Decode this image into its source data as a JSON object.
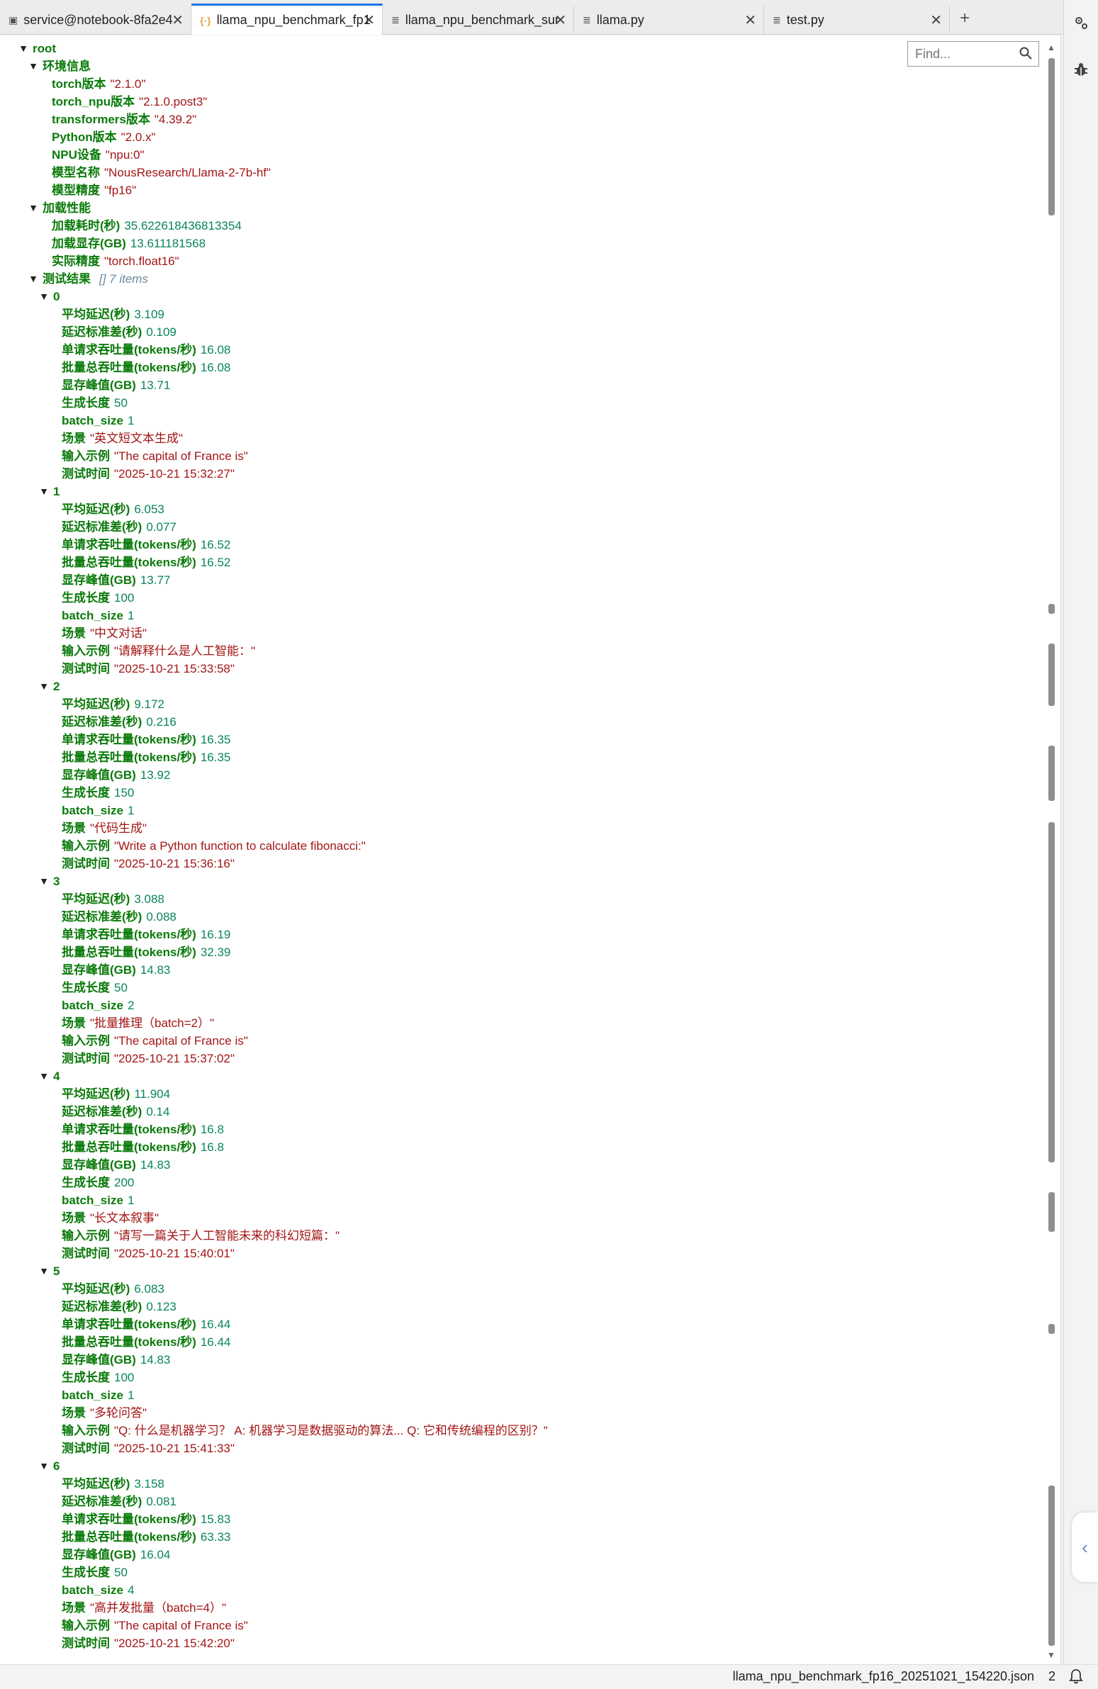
{
  "tabs": [
    {
      "icon": "terminal-icon",
      "label": "service@notebook-8fa2e4"
    },
    {
      "icon": "json-icon",
      "label": "llama_npu_benchmark_fp1"
    },
    {
      "icon": "text-file-icon",
      "label": "llama_npu_benchmark_sur"
    },
    {
      "icon": "text-file-icon",
      "label": "llama.py"
    },
    {
      "icon": "text-file-icon",
      "label": "test.py"
    }
  ],
  "find": {
    "placeholder": "Find..."
  },
  "tree": {
    "root": "root",
    "env_key": "环境信息",
    "env": [
      {
        "k": "torch版本",
        "v": "\"2.1.0\"",
        "t": "s"
      },
      {
        "k": "torch_npu版本",
        "v": "\"2.1.0.post3\"",
        "t": "s"
      },
      {
        "k": "transformers版本",
        "v": "\"4.39.2\"",
        "t": "s"
      },
      {
        "k": "Python版本",
        "v": "\"2.0.x\"",
        "t": "s"
      },
      {
        "k": "NPU设备",
        "v": "\"npu:0\"",
        "t": "s"
      },
      {
        "k": "模型名称",
        "v": "\"NousResearch/Llama-2-7b-hf\"",
        "t": "s"
      },
      {
        "k": "模型精度",
        "v": "\"fp16\"",
        "t": "s"
      }
    ],
    "load_key": "加载性能",
    "load": [
      {
        "k": "加载耗时(秒)",
        "v": "35.622618436813354",
        "t": "n"
      },
      {
        "k": "加载显存(GB)",
        "v": "13.611181568",
        "t": "n"
      },
      {
        "k": "实际精度",
        "v": "\"torch.float16\"",
        "t": "s"
      }
    ],
    "results_key": "测试结果",
    "results_meta": "[]  7 items",
    "results": [
      {
        "index": "0",
        "fields": [
          {
            "k": "平均延迟(秒)",
            "v": "3.109",
            "t": "n"
          },
          {
            "k": "延迟标准差(秒)",
            "v": "0.109",
            "t": "n"
          },
          {
            "k": "单请求吞吐量(tokens/秒)",
            "v": "16.08",
            "t": "n"
          },
          {
            "k": "批量总吞吐量(tokens/秒)",
            "v": "16.08",
            "t": "n"
          },
          {
            "k": "显存峰值(GB)",
            "v": "13.71",
            "t": "n"
          },
          {
            "k": "生成长度",
            "v": "50",
            "t": "n"
          },
          {
            "k": "batch_size",
            "v": "1",
            "t": "n"
          },
          {
            "k": "场景",
            "v": "\"英文短文本生成\"",
            "t": "s"
          },
          {
            "k": "输入示例",
            "v": "\"The capital of France is\"",
            "t": "s"
          },
          {
            "k": "测试时间",
            "v": "\"2025-10-21 15:32:27\"",
            "t": "s"
          }
        ]
      },
      {
        "index": "1",
        "fields": [
          {
            "k": "平均延迟(秒)",
            "v": "6.053",
            "t": "n"
          },
          {
            "k": "延迟标准差(秒)",
            "v": "0.077",
            "t": "n"
          },
          {
            "k": "单请求吞吐量(tokens/秒)",
            "v": "16.52",
            "t": "n"
          },
          {
            "k": "批量总吞吐量(tokens/秒)",
            "v": "16.52",
            "t": "n"
          },
          {
            "k": "显存峰值(GB)",
            "v": "13.77",
            "t": "n"
          },
          {
            "k": "生成长度",
            "v": "100",
            "t": "n"
          },
          {
            "k": "batch_size",
            "v": "1",
            "t": "n"
          },
          {
            "k": "场景",
            "v": "\"中文对话\"",
            "t": "s"
          },
          {
            "k": "输入示例",
            "v": "\"请解释什么是人工智能：\"",
            "t": "s"
          },
          {
            "k": "测试时间",
            "v": "\"2025-10-21 15:33:58\"",
            "t": "s"
          }
        ]
      },
      {
        "index": "2",
        "fields": [
          {
            "k": "平均延迟(秒)",
            "v": "9.172",
            "t": "n"
          },
          {
            "k": "延迟标准差(秒)",
            "v": "0.216",
            "t": "n"
          },
          {
            "k": "单请求吞吐量(tokens/秒)",
            "v": "16.35",
            "t": "n"
          },
          {
            "k": "批量总吞吐量(tokens/秒)",
            "v": "16.35",
            "t": "n"
          },
          {
            "k": "显存峰值(GB)",
            "v": "13.92",
            "t": "n"
          },
          {
            "k": "生成长度",
            "v": "150",
            "t": "n"
          },
          {
            "k": "batch_size",
            "v": "1",
            "t": "n"
          },
          {
            "k": "场景",
            "v": "\"代码生成\"",
            "t": "s"
          },
          {
            "k": "输入示例",
            "v": "\"Write a Python function to calculate fibonacci:\"",
            "t": "s"
          },
          {
            "k": "测试时间",
            "v": "\"2025-10-21 15:36:16\"",
            "t": "s"
          }
        ]
      },
      {
        "index": "3",
        "fields": [
          {
            "k": "平均延迟(秒)",
            "v": "3.088",
            "t": "n"
          },
          {
            "k": "延迟标准差(秒)",
            "v": "0.088",
            "t": "n"
          },
          {
            "k": "单请求吞吐量(tokens/秒)",
            "v": "16.19",
            "t": "n"
          },
          {
            "k": "批量总吞吐量(tokens/秒)",
            "v": "32.39",
            "t": "n"
          },
          {
            "k": "显存峰值(GB)",
            "v": "14.83",
            "t": "n"
          },
          {
            "k": "生成长度",
            "v": "50",
            "t": "n"
          },
          {
            "k": "batch_size",
            "v": "2",
            "t": "n"
          },
          {
            "k": "场景",
            "v": "\"批量推理（batch=2）\"",
            "t": "s"
          },
          {
            "k": "输入示例",
            "v": "\"The capital of France is\"",
            "t": "s"
          },
          {
            "k": "测试时间",
            "v": "\"2025-10-21 15:37:02\"",
            "t": "s"
          }
        ]
      },
      {
        "index": "4",
        "fields": [
          {
            "k": "平均延迟(秒)",
            "v": "11.904",
            "t": "n"
          },
          {
            "k": "延迟标准差(秒)",
            "v": "0.14",
            "t": "n"
          },
          {
            "k": "单请求吞吐量(tokens/秒)",
            "v": "16.8",
            "t": "n"
          },
          {
            "k": "批量总吞吐量(tokens/秒)",
            "v": "16.8",
            "t": "n"
          },
          {
            "k": "显存峰值(GB)",
            "v": "14.83",
            "t": "n"
          },
          {
            "k": "生成长度",
            "v": "200",
            "t": "n"
          },
          {
            "k": "batch_size",
            "v": "1",
            "t": "n"
          },
          {
            "k": "场景",
            "v": "\"长文本叙事\"",
            "t": "s"
          },
          {
            "k": "输入示例",
            "v": "\"请写一篇关于人工智能未来的科幻短篇：\"",
            "t": "s"
          },
          {
            "k": "测试时间",
            "v": "\"2025-10-21 15:40:01\"",
            "t": "s"
          }
        ]
      },
      {
        "index": "5",
        "fields": [
          {
            "k": "平均延迟(秒)",
            "v": "6.083",
            "t": "n"
          },
          {
            "k": "延迟标准差(秒)",
            "v": "0.123",
            "t": "n"
          },
          {
            "k": "单请求吞吐量(tokens/秒)",
            "v": "16.44",
            "t": "n"
          },
          {
            "k": "批量总吞吐量(tokens/秒)",
            "v": "16.44",
            "t": "n"
          },
          {
            "k": "显存峰值(GB)",
            "v": "14.83",
            "t": "n"
          },
          {
            "k": "生成长度",
            "v": "100",
            "t": "n"
          },
          {
            "k": "batch_size",
            "v": "1",
            "t": "n"
          },
          {
            "k": "场景",
            "v": "\"多轮问答\"",
            "t": "s"
          },
          {
            "k": "输入示例",
            "v": "\"Q: 什么是机器学习？ A: 机器学习是数据驱动的算法... Q: 它和传统编程的区别？\"",
            "t": "s"
          },
          {
            "k": "测试时间",
            "v": "\"2025-10-21 15:41:33\"",
            "t": "s"
          }
        ]
      },
      {
        "index": "6",
        "fields": [
          {
            "k": "平均延迟(秒)",
            "v": "3.158",
            "t": "n"
          },
          {
            "k": "延迟标准差(秒)",
            "v": "0.081",
            "t": "n"
          },
          {
            "k": "单请求吞吐量(tokens/秒)",
            "v": "15.83",
            "t": "n"
          },
          {
            "k": "批量总吞吐量(tokens/秒)",
            "v": "63.33",
            "t": "n"
          },
          {
            "k": "显存峰值(GB)",
            "v": "16.04",
            "t": "n"
          },
          {
            "k": "生成长度",
            "v": "50",
            "t": "n"
          },
          {
            "k": "batch_size",
            "v": "4",
            "t": "n"
          },
          {
            "k": "场景",
            "v": "\"高并发批量（batch=4）\"",
            "t": "s"
          },
          {
            "k": "输入示例",
            "v": "\"The capital of France is\"",
            "t": "s"
          },
          {
            "k": "测试时间",
            "v": "\"2025-10-21 15:42:20\"",
            "t": "s"
          }
        ]
      }
    ]
  },
  "side_icons": [
    "settings-gear-icon",
    "debug-bug-icon"
  ],
  "status": {
    "filename": "llama_npu_benchmark_fp16_20251021_154220.json",
    "count": "2"
  },
  "colors": {
    "key": "#0a7a0a",
    "number": "#098658",
    "string": "#a31515",
    "active_tab_accent": "#1a73e8"
  }
}
